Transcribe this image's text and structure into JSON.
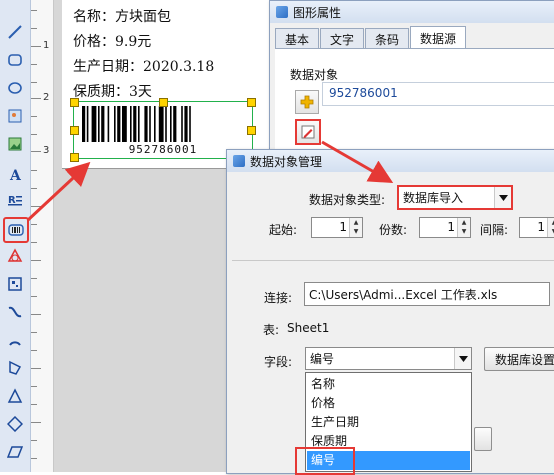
{
  "toolbar": {
    "tools": [
      {
        "icon": "line-icon"
      },
      {
        "icon": "rounded-rect-icon"
      },
      {
        "icon": "ellipse-icon"
      },
      {
        "icon": "image-icon"
      },
      {
        "icon": "picture-icon"
      },
      {
        "icon": "text-icon"
      },
      {
        "icon": "rich-text-icon"
      },
      {
        "icon": "barcode-icon"
      },
      {
        "icon": "shape-icon"
      },
      {
        "icon": "qrcode-icon"
      },
      {
        "icon": "curve-icon"
      },
      {
        "icon": "arc-icon"
      },
      {
        "icon": "polygon-icon"
      },
      {
        "icon": "triangle-icon"
      },
      {
        "icon": "diamond-icon"
      },
      {
        "icon": "parallelogram-icon"
      }
    ],
    "accent": "#e53935"
  },
  "ruler": {
    "marks": [
      "1",
      "2",
      "3"
    ]
  },
  "label": {
    "line1": "名称：方块面包",
    "line2": "价格：9.9元",
    "line3": "生产日期：2020.3.18",
    "line4": "保质期：3天",
    "barcode_text": "952786001"
  },
  "props_window": {
    "title": "图形属性",
    "tabs": [
      "基本",
      "文字",
      "条码",
      "数据源"
    ],
    "active_tab": "数据源",
    "group_label": "数据对象",
    "object_value": "952786001"
  },
  "data_manager": {
    "title": "数据对象管理",
    "type_label": "数据对象类型:",
    "type_value": "数据库导入",
    "start_label": "起始:",
    "start_value": "1",
    "digits_label": "份数:",
    "digits_value": "1",
    "interval_label": "间隔:",
    "interval_value": "1",
    "connect_label": "连接:",
    "connect_value": "C:\\Users\\Admi...Excel 工作表.xls",
    "table_label": "表:",
    "table_value": "Sheet1",
    "field_label": "字段:",
    "field_value": "编号",
    "db_settings_button": "数据库设置",
    "field_options": [
      "名称",
      "价格",
      "生产日期",
      "保质期",
      "编号"
    ],
    "selected_option": "编号"
  }
}
